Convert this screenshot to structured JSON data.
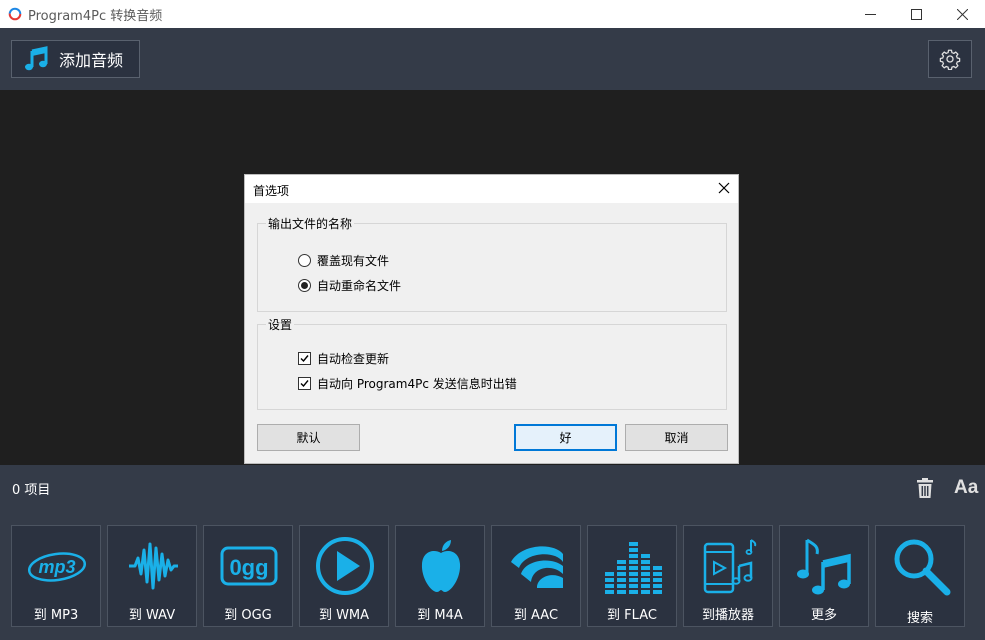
{
  "window": {
    "title": "Program4Pc 转换音频",
    "controls": [
      "minimize-icon",
      "maximize-icon",
      "close-icon"
    ]
  },
  "toolbar": {
    "add_audio_label": "添加音频",
    "add_audio_icon": "music-note-icon",
    "settings_icon": "gear-icon"
  },
  "status": {
    "items_count_label": "0 项目",
    "trash_icon": "trash-icon",
    "font_label": "Aa"
  },
  "formats": [
    {
      "label": "到 MP3",
      "icon": "mp3-icon"
    },
    {
      "label": "到 WAV",
      "icon": "waveform-icon"
    },
    {
      "label": "到 OGG",
      "icon": "ogg-icon"
    },
    {
      "label": "到 WMA",
      "icon": "play-circle-icon"
    },
    {
      "label": "到 M4A",
      "icon": "apple-icon"
    },
    {
      "label": "到 AAC",
      "icon": "aac-icon"
    },
    {
      "label": "到 FLAC",
      "icon": "equalizer-icon"
    },
    {
      "label": "到播放器",
      "icon": "phone-music-icon"
    },
    {
      "label": "更多",
      "icon": "music-notes-icon"
    },
    {
      "label": "搜索",
      "icon": "search-icon"
    }
  ],
  "dialog": {
    "title": "首选项",
    "output_group_label": "输出文件的名称",
    "radio_overwrite": "覆盖现有文件",
    "radio_rename": "自动重命名文件",
    "selected_option": "自动重命名文件",
    "settings_group_label": "设置",
    "check_updates": "自动检查更新",
    "check_updates_checked": true,
    "check_report": "自动向 Program4Pc 发送信息时出错",
    "check_report_checked": true,
    "btn_default": "默认",
    "btn_ok": "好",
    "btn_cancel": "取消"
  },
  "colors": {
    "accent": "#1ab0e8",
    "toolbar_bg": "#343b48",
    "button_bg": "#2b3240",
    "content_bg": "#1f1f1f"
  }
}
